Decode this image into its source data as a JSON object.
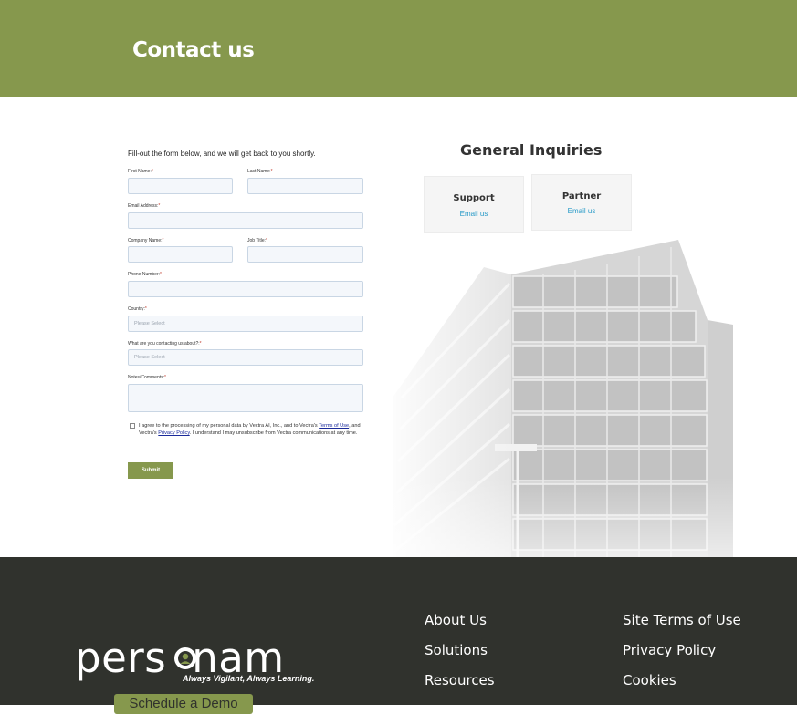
{
  "header": {
    "title": "Contact us"
  },
  "form": {
    "intro": "Fill-out the form below, and we will get back to you shortly.",
    "first_name_label": "First Name:",
    "last_name_label": "Last Name:",
    "email_label": "Email Address:",
    "company_label": "Company Name:",
    "job_title_label": "Job Title:",
    "phone_label": "Phone Number:",
    "country_label": "Country:",
    "country_placeholder": "Please Select",
    "topic_label": "What are you contacting us about?:",
    "topic_placeholder": "Please Select",
    "notes_label": "Notes/Comments:",
    "required_mark": "*",
    "consent_part1": "I agree to the processing of my personal data by Vectra AI, Inc., and to Vectra's",
    "terms_link": "Terms of Use",
    "consent_part2": ", and Vectra's",
    "privacy_link": "Privacy Policy",
    "consent_part3": ". I understand I may unsubscribe from Vectra communications at any time.",
    "submit_label": "Submit"
  },
  "inquiries": {
    "title": "General Inquiries",
    "cards": [
      {
        "title": "Support",
        "link": "Email us"
      },
      {
        "title": "Partner",
        "link": "Email us"
      }
    ]
  },
  "footer": {
    "logo_pre": "pers",
    "logo_post": "nam",
    "tagline": "Always Vigilant, Always Learning.",
    "demo_button": "Schedule a Demo",
    "col1": [
      "About Us",
      "Solutions",
      "Resources"
    ],
    "col2": [
      "Site Terms of Use",
      "Privacy Policy",
      "Cookies"
    ]
  },
  "colors": {
    "brand_green": "#86984d",
    "footer_bg": "#30322d",
    "link_blue": "#2a9bc8"
  }
}
